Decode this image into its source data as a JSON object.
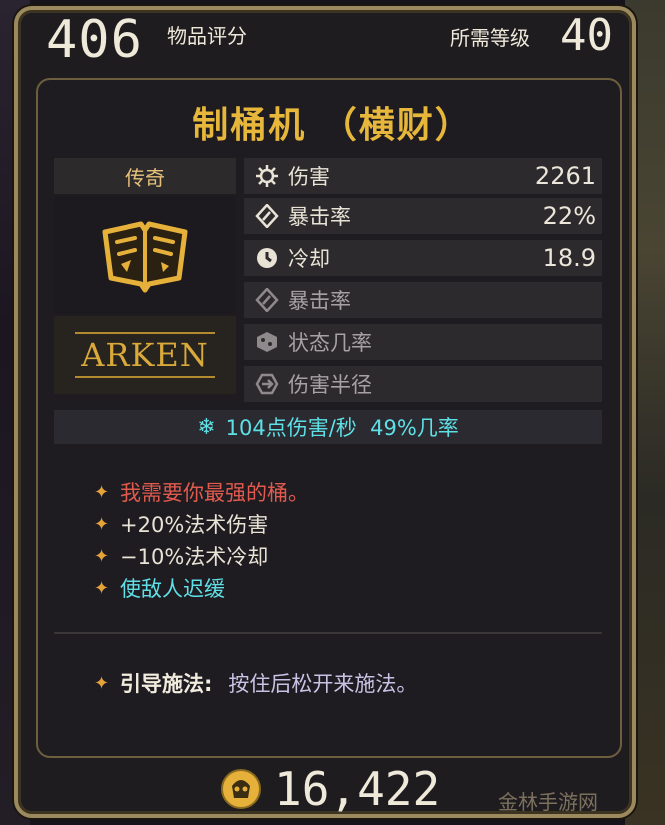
{
  "header": {
    "item_score": "406",
    "item_score_label": "物品评分",
    "level_label": "所需等级",
    "level": "40"
  },
  "item": {
    "name": "制桶机 （横财）",
    "rarity": "传奇",
    "brand": "ARKEN",
    "icon": "spellbook-icon"
  },
  "stats": [
    {
      "label": "伤害",
      "value": "2261",
      "icon": "damage-icon"
    },
    {
      "label": "暴击率",
      "value": "22%",
      "icon": "crit-icon"
    },
    {
      "label": "冷却",
      "value": "18.9",
      "icon": "cooldown-icon"
    },
    {
      "label": "暴击率",
      "value": "",
      "icon": "crit-icon"
    },
    {
      "label": "状态几率",
      "value": "",
      "icon": "status-icon"
    },
    {
      "label": "伤害半径",
      "value": "",
      "icon": "radius-icon"
    }
  ],
  "element": {
    "text": "104点伤害/秒  49%几率",
    "icon": "cryo-icon",
    "color": "#5fe0e6"
  },
  "effects": [
    {
      "text": "我需要你最强的桶。",
      "color": "#e05a4e"
    },
    {
      "text": "+20%法术伤害",
      "color": "#e9e3d6"
    },
    {
      "text": "−10%法术冷却",
      "color": "#e9e3d6"
    },
    {
      "text": "使敌人迟缓",
      "color": "#5fe0e6"
    }
  ],
  "channel": {
    "label": "引导施法:",
    "desc": "按住后松开来施法。"
  },
  "price": {
    "value": "16,422",
    "icon": "money-icon"
  },
  "watermark": "金林手游网"
}
